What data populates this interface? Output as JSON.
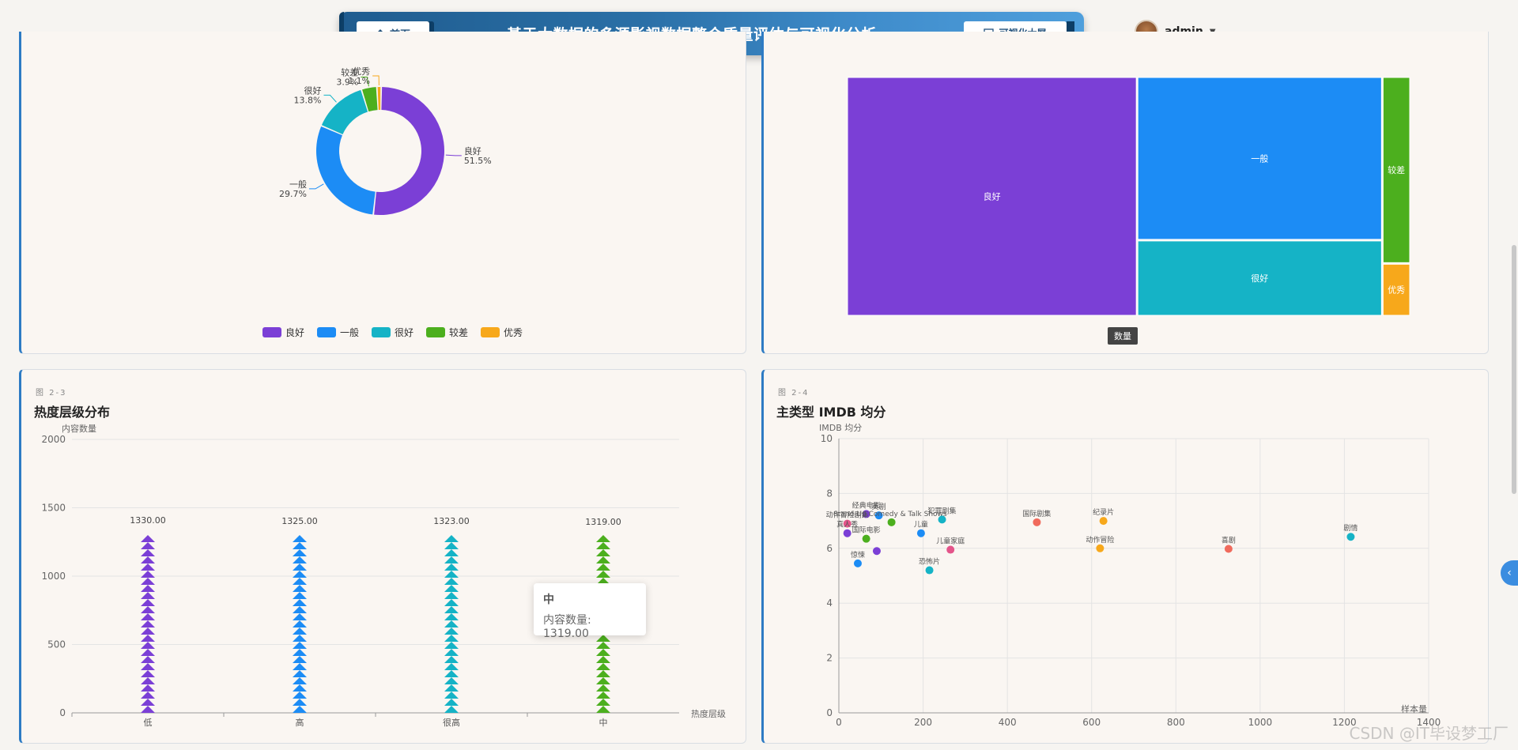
{
  "header": {
    "home_label": "首页",
    "title": "基于大数据的多源影视数据整合质量评估与可视化分析",
    "screen_label": "可视化大屏",
    "user_name": "admin",
    "icons": {
      "home": "home-icon",
      "screen": "monitor-icon",
      "caret": "caret-down-icon"
    }
  },
  "panels": {
    "p3": {
      "fig": "图 2-3",
      "title": "热度层级分布"
    },
    "p4": {
      "fig": "图 2-4",
      "title": "主类型 IMDB 均分"
    }
  },
  "colors": {
    "purple": "#7b3fd6",
    "blue": "#1c8cf5",
    "teal": "#15b3c6",
    "green": "#4caf1e",
    "orange": "#f7a81b",
    "accent": "#2d7bc4"
  },
  "chart_data": [
    {
      "type": "pie",
      "variant": "donut",
      "slices": [
        {
          "name": "良好",
          "value": 51.5,
          "label": "51.5%",
          "color": "#7b3fd6"
        },
        {
          "name": "一般",
          "value": 29.7,
          "label": "29.7%",
          "color": "#1c8cf5"
        },
        {
          "name": "很好",
          "value": 13.8,
          "label": "13.8%",
          "color": "#15b3c6"
        },
        {
          "name": "较差",
          "value": 3.9,
          "label": "3.9%",
          "color": "#4caf1e"
        },
        {
          "name": "优秀",
          "value": 1.1,
          "label": "1.1%",
          "color": "#f7a81b"
        }
      ],
      "legend": [
        "良好",
        "一般",
        "很好",
        "较差",
        "优秀"
      ],
      "legend_position": "bottom"
    },
    {
      "type": "treemap",
      "tooltip_label": "数量",
      "nodes": [
        {
          "name": "良好",
          "value": 51.5,
          "color": "#7b3fd6"
        },
        {
          "name": "一般",
          "value": 29.7,
          "color": "#1c8cf5"
        },
        {
          "name": "很好",
          "value": 13.8,
          "color": "#15b3c6"
        },
        {
          "name": "较差",
          "value": 3.9,
          "color": "#4caf1e"
        },
        {
          "name": "优秀",
          "value": 1.1,
          "color": "#f7a81b"
        }
      ]
    },
    {
      "type": "bar",
      "variant": "pictorial-triangles",
      "categories": [
        "低",
        "高",
        "很高",
        "中"
      ],
      "values": [
        1330,
        1325,
        1323,
        1319
      ],
      "value_labels": [
        "1330.00",
        "1325.00",
        "1323.00",
        "1319.00"
      ],
      "colors": [
        "#7b3fd6",
        "#1c8cf5",
        "#15b3c6",
        "#4caf1e"
      ],
      "ylabel": "内容数量",
      "xlabel": "热度层级",
      "ylim": [
        0,
        2000
      ],
      "yticks": [
        0,
        500,
        1000,
        1500,
        2000
      ],
      "tooltip": {
        "title": "中",
        "label": "内容数量:",
        "value": "1319.00"
      }
    },
    {
      "type": "scatter",
      "ylabel": "IMDB 均分",
      "xlabel": "样本量",
      "xlim": [
        0,
        1400
      ],
      "ylim": [
        0,
        10
      ],
      "xticks": [
        0,
        200,
        400,
        600,
        800,
        1000,
        1200,
        1400
      ],
      "yticks": [
        0,
        2,
        4,
        6,
        8,
        10
      ],
      "points": [
        {
          "name": "经典电影",
          "x": 65,
          "y": 7.25,
          "color": "#7b3fd6"
        },
        {
          "name": "英剧",
          "x": 95,
          "y": 7.2,
          "color": "#1c8cf5"
        },
        {
          "name": "动作冒险剧集",
          "x": 20,
          "y": 6.9,
          "color": "#e4548a"
        },
        {
          "name": "Stand-Up Comedy & Talk Shows",
          "x": 125,
          "y": 6.95,
          "color": "#4caf1e"
        },
        {
          "name": "犯罪剧集",
          "x": 245,
          "y": 7.05,
          "color": "#15b3c6"
        },
        {
          "name": "儿童",
          "x": 195,
          "y": 6.55,
          "color": "#1c8cf5"
        },
        {
          "name": "真人秀",
          "x": 20,
          "y": 6.55,
          "color": "#7b3fd6"
        },
        {
          "name": "国际电影",
          "x": 65,
          "y": 6.35,
          "color": "#4caf1e"
        },
        {
          "name": "惊悚",
          "x": 45,
          "y": 5.45,
          "color": "#1c8cf5"
        },
        {
          "name": "",
          "x": 90,
          "y": 5.9,
          "color": "#7b3fd6"
        },
        {
          "name": "儿童家庭",
          "x": 265,
          "y": 5.95,
          "color": "#e4548a"
        },
        {
          "name": "恐怖片",
          "x": 215,
          "y": 5.2,
          "color": "#15b3c6"
        },
        {
          "name": "国际剧集",
          "x": 470,
          "y": 6.95,
          "color": "#f06a5c"
        },
        {
          "name": "纪录片",
          "x": 628,
          "y": 7.0,
          "color": "#f7a81b"
        },
        {
          "name": "动作冒险",
          "x": 620,
          "y": 6.0,
          "color": "#f7a81b"
        },
        {
          "name": "喜剧",
          "x": 925,
          "y": 5.98,
          "color": "#f06a5c"
        },
        {
          "name": "剧情",
          "x": 1215,
          "y": 6.42,
          "color": "#15b3c6"
        }
      ]
    }
  ],
  "watermark": "CSDN @IT毕设梦工厂"
}
